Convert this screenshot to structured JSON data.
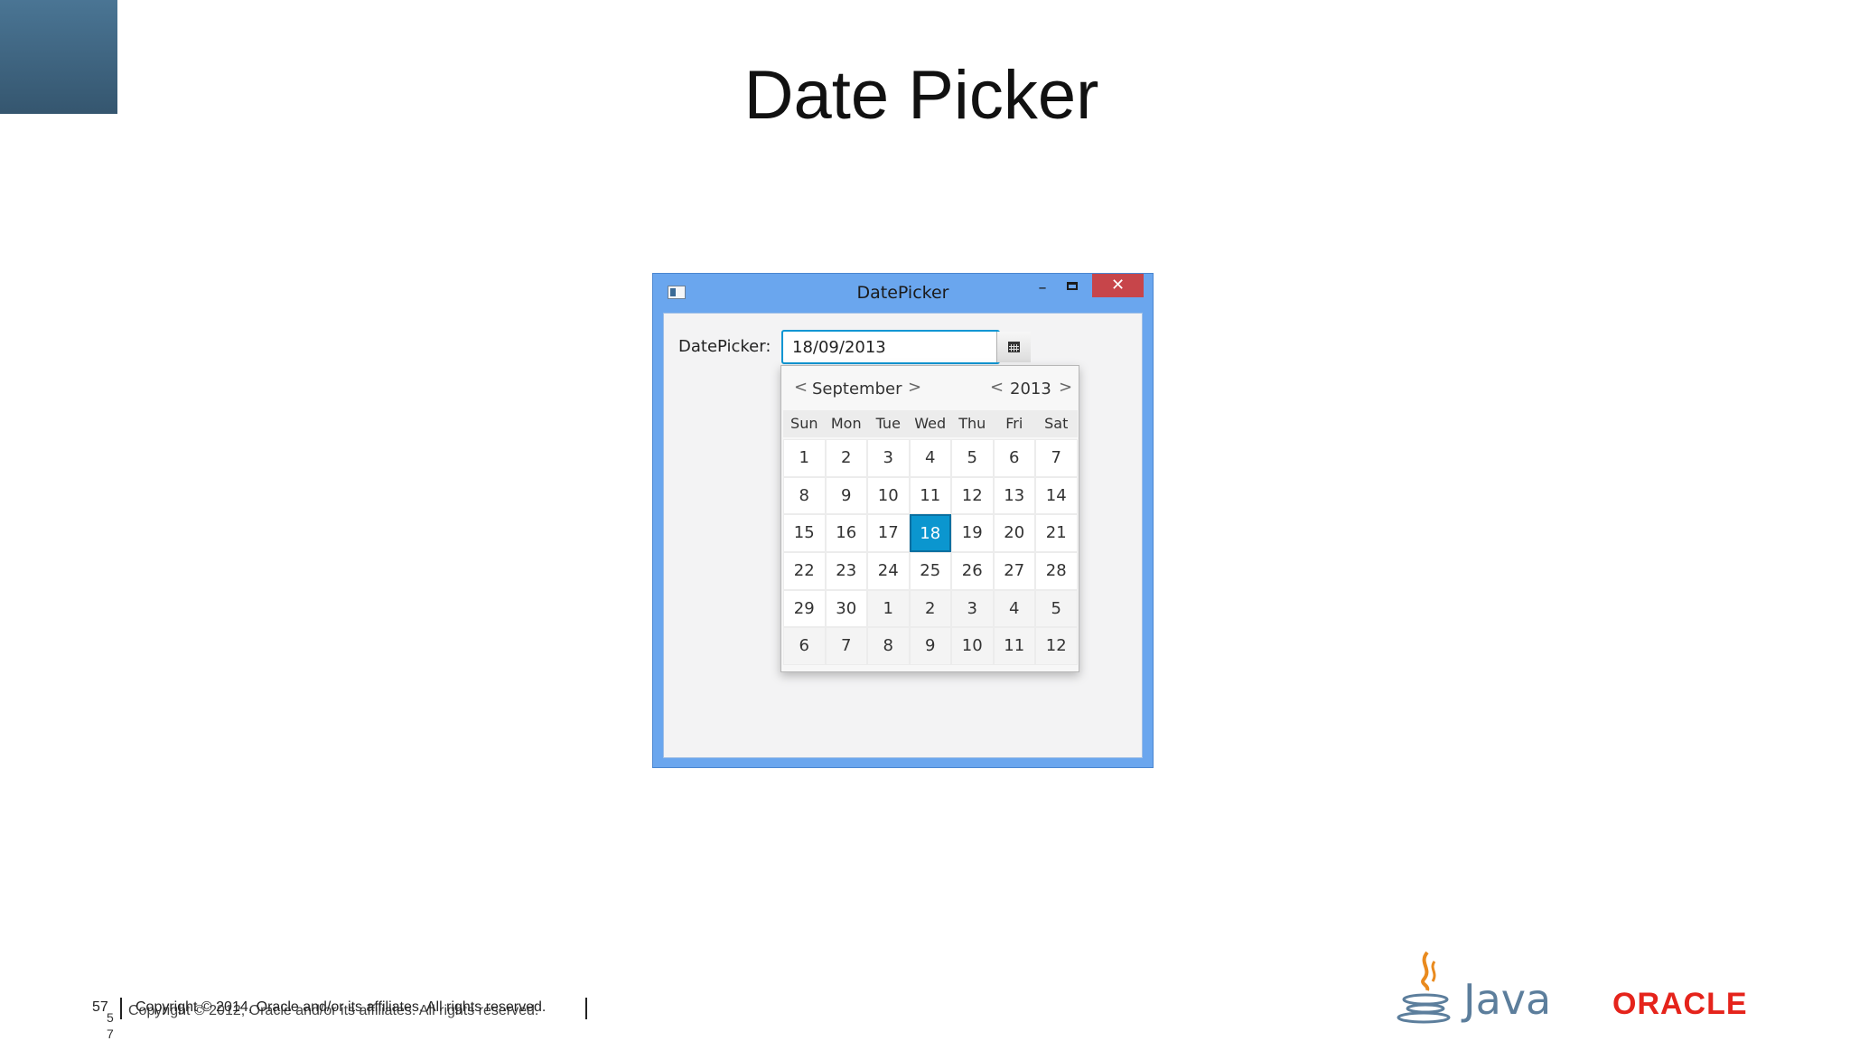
{
  "slide": {
    "title": "Date Picker"
  },
  "window": {
    "title": "DatePicker",
    "minimize": "–",
    "close": "✕"
  },
  "datepicker": {
    "label": "DatePicker:",
    "value": "18/09/2013",
    "button_icon": "calendar-icon"
  },
  "calendar": {
    "month": "September",
    "year": "2013",
    "prev": "<",
    "next": ">",
    "weekdays": [
      "Sun",
      "Mon",
      "Tue",
      "Wed",
      "Thu",
      "Fri",
      "Sat"
    ],
    "weeks": [
      [
        "1",
        "2",
        "3",
        "4",
        "5",
        "6",
        "7"
      ],
      [
        "8",
        "9",
        "10",
        "11",
        "12",
        "13",
        "14"
      ],
      [
        "15",
        "16",
        "17",
        "18",
        "19",
        "20",
        "21"
      ],
      [
        "22",
        "23",
        "24",
        "25",
        "26",
        "27",
        "28"
      ],
      [
        "29",
        "30",
        "1",
        "2",
        "3",
        "4",
        "5"
      ],
      [
        "6",
        "7",
        "8",
        "9",
        "10",
        "11",
        "12"
      ]
    ],
    "selected": "18"
  },
  "footer": {
    "page": "57",
    "copyright": "Copyright © 2014, Oracle and/or its affiliates. All rights reserved.",
    "copyright_old": "Copyright © 2012, Oracle and/or its affiliates. All rights reserved.",
    "page_small_1": "5",
    "page_small_2": "7",
    "java": "Java",
    "oracle": "ORACLE"
  }
}
